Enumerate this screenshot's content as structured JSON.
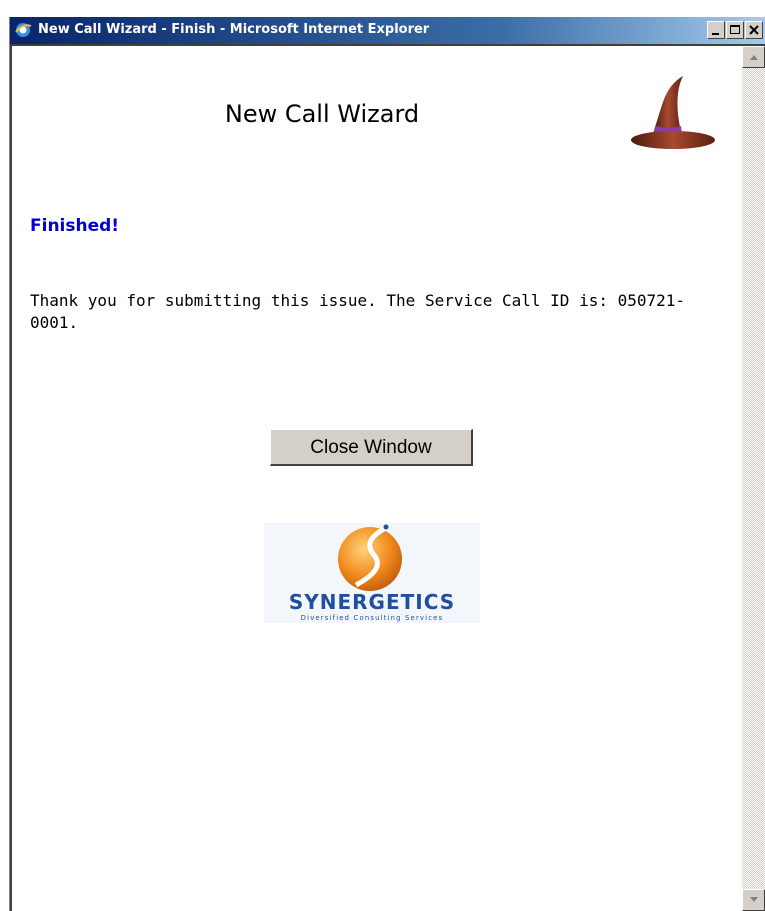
{
  "window": {
    "title": "New Call Wizard - Finish - Microsoft Internet Explorer",
    "icon": "ie-icon",
    "buttons": [
      "minimize-icon",
      "maximize-icon",
      "close-icon"
    ]
  },
  "page": {
    "heading": "New Call Wizard",
    "status": "Finished!",
    "message": "Thank you for submitting this issue. The Service Call ID is: 050721-0001.",
    "close_button_label": "Close Window"
  },
  "logo": {
    "name": "SYNERGETICS",
    "tagline": "Diversified Consulting Services",
    "accent_color": "#f08a1c",
    "text_color": "#1f4fa0"
  },
  "colors": {
    "status_text": "#0000d8",
    "titlebar_start": "#0a246a",
    "titlebar_end": "#a6caf0"
  }
}
